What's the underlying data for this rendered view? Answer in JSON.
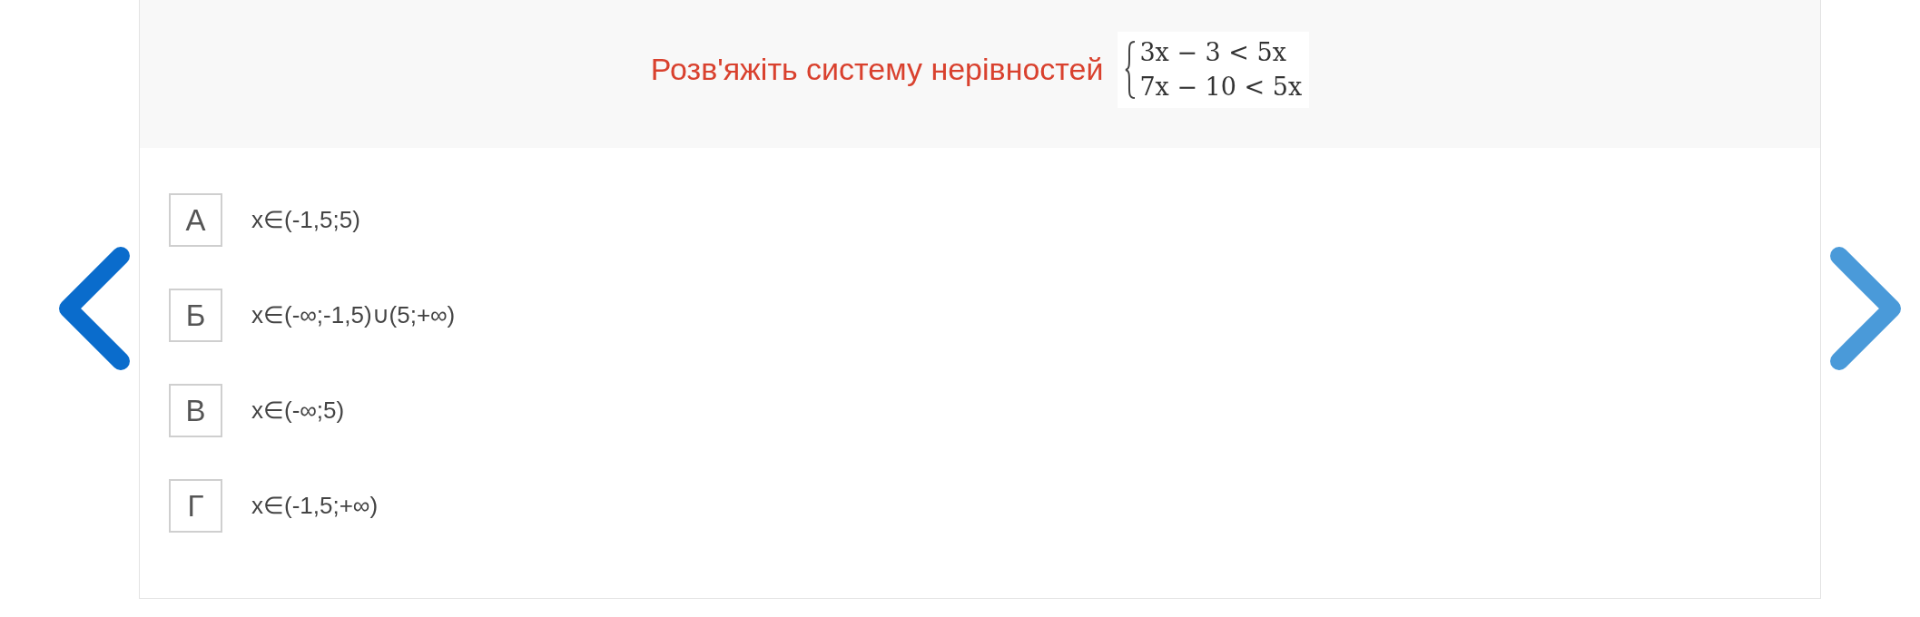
{
  "question": {
    "title": "Розв'яжіть систему нерівностей",
    "system": [
      "3x − 3 < 5x",
      "7x − 10 < 5x"
    ]
  },
  "options": [
    {
      "letter": "А",
      "text": "x∈(-1,5;5)"
    },
    {
      "letter": "Б",
      "text": "x∈(-∞;-1,5)∪(5;+∞)"
    },
    {
      "letter": "В",
      "text": "x∈(-∞;5)"
    },
    {
      "letter": "Г",
      "text": "x∈(-1,5;+∞)"
    }
  ]
}
